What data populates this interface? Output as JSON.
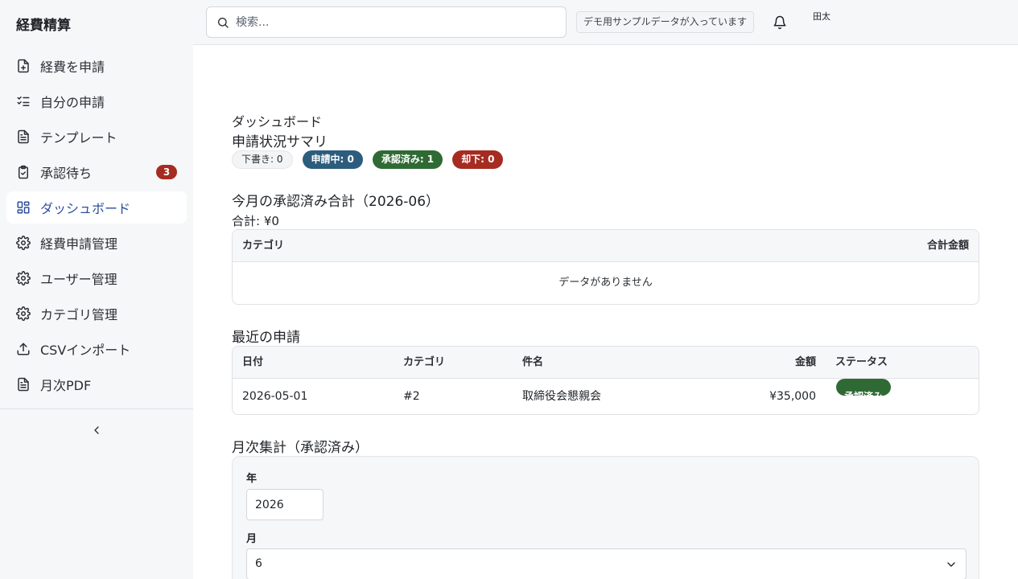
{
  "app": {
    "title": "経費精算"
  },
  "sidebar": {
    "items": [
      {
        "label": "経費を申請",
        "icon": "file-plus-icon"
      },
      {
        "label": "自分の申請",
        "icon": "list-check-icon"
      },
      {
        "label": "テンプレート",
        "icon": "file-text-icon"
      },
      {
        "label": "承認待ち",
        "icon": "clipboard-check-icon",
        "badge": "3"
      },
      {
        "label": "ダッシュボード",
        "icon": "dashboard-grid-icon",
        "active": true
      },
      {
        "label": "経費申請管理",
        "icon": "gear-icon"
      },
      {
        "label": "ユーザー管理",
        "icon": "gear-icon"
      },
      {
        "label": "カテゴリ管理",
        "icon": "gear-icon"
      },
      {
        "label": "CSVインポート",
        "icon": "upload-icon"
      },
      {
        "label": "月次PDF",
        "icon": "file-text-icon"
      }
    ],
    "collapse_icon": "chevron-left-icon"
  },
  "topbar": {
    "search_placeholder": "検索...",
    "demo_note": "デモ用サンプルデータが入っています",
    "bell_icon": "bell-icon",
    "avatar_text": "田太"
  },
  "dashboard": {
    "page_title": "ダッシュボード",
    "summary_title": "申請状況サマリ",
    "badges": {
      "draft": "下書き: 0",
      "pending": "申請中: 0",
      "approved": "承認済み: 1",
      "rejected": "却下: 0"
    },
    "month_title": "今月の承認済み合計（2026-06）",
    "total_label": "合計: ¥0",
    "category_table": {
      "headers": {
        "category": "カテゴリ",
        "amount": "合計金額"
      },
      "empty_text": "データがありません"
    },
    "recent_title": "最近の申請",
    "recent_table": {
      "headers": {
        "date": "日付",
        "category": "カテゴリ",
        "subject": "件名",
        "amount": "金額",
        "status": "ステータス"
      },
      "rows": [
        {
          "date": "2026-05-01",
          "category": "#2",
          "subject": "取締役会懇親会",
          "amount": "¥35,000",
          "status": "承認済み"
        }
      ]
    },
    "monthly_title": "月次集計（承認済み）",
    "monthly": {
      "year_label": "年",
      "year_value": "2026",
      "month_label": "月",
      "month_value": "6"
    }
  },
  "colors": {
    "active_nav": "#2c4f9c",
    "pending": "#2d5d7c",
    "approved": "#2f6a34",
    "rejected": "#a62b21"
  }
}
